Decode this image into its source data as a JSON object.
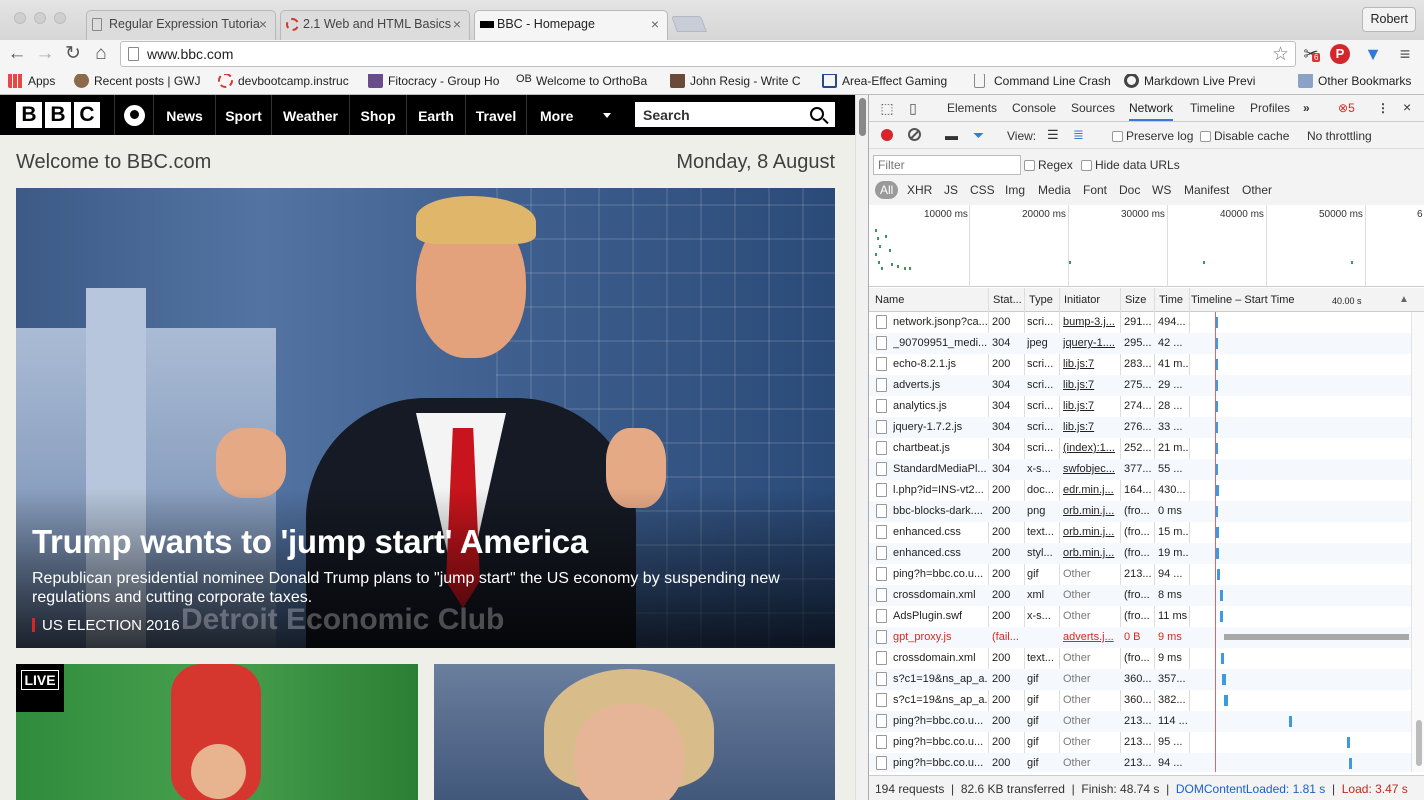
{
  "browser": {
    "tabs": [
      {
        "title": "Regular Expression Tutoria",
        "icon": "doc-icon"
      },
      {
        "title": "2.1 Web and HTML Basics",
        "icon": "ring-icon"
      },
      {
        "title": "BBC - Homepage",
        "icon": "bbc-icon"
      }
    ],
    "user": "Robert",
    "url": "www.bbc.com",
    "extension_badge": "6",
    "bookmarks": [
      "Apps",
      "Recent posts | GWJ",
      "devbootcamp.instruc",
      "Fitocracy - Group Ho",
      "Welcome to OrthoBa",
      "John Resig - Write C",
      "Area-Effect Gaming",
      "Command Line Crash",
      "Markdown Live Previ",
      "Other Bookmarks"
    ]
  },
  "bbc": {
    "logo": [
      "B",
      "B",
      "C"
    ],
    "nav": [
      "News",
      "Sport",
      "Weather",
      "Shop",
      "Earth",
      "Travel",
      "More"
    ],
    "search_placeholder": "Search",
    "welcome": "Welcome to BBC.com",
    "date": "Monday, 8 August",
    "hero": {
      "headline": "Trump wants to 'jump start' America",
      "summary": "Republican presidential nominee Donald Trump plans to \"jump start\" the US economy by suspending new regulations and cutting corporate taxes.",
      "tag": "US ELECTION 2016",
      "backdrop_text": "Detroit Economic Club"
    },
    "live_badge": "LIVE"
  },
  "devtools": {
    "tabs": [
      "Elements",
      "Console",
      "Sources",
      "Network",
      "Timeline",
      "Profiles"
    ],
    "active_tab": "Network",
    "error_count": "5",
    "toolbar": {
      "view_label": "View:",
      "preserve_log": "Preserve log",
      "disable_cache": "Disable cache",
      "throttling": "No throttling"
    },
    "filter_placeholder": "Filter",
    "regex_label": "Regex",
    "hide_data_urls": "Hide data URLs",
    "types": [
      "All",
      "XHR",
      "JS",
      "CSS",
      "Img",
      "Media",
      "Font",
      "Doc",
      "WS",
      "Manifest",
      "Other"
    ],
    "overview_ticks": [
      "10000 ms",
      "20000 ms",
      "30000 ms",
      "40000 ms",
      "50000 ms",
      "6"
    ],
    "columns": {
      "name": "Name",
      "status": "Stat...",
      "type": "Type",
      "initiator": "Initiator",
      "size": "Size",
      "time": "Time",
      "timeline": "Timeline – Start Time",
      "timeline_scale": "40.00 s"
    },
    "rows": [
      {
        "name": "network.jsonp?ca...",
        "status": "200",
        "type": "scri...",
        "initiator": "bump-3.j...",
        "size": "291...",
        "time": "494...",
        "icon": "doc-icon"
      },
      {
        "name": "_90709951_medi...",
        "status": "304",
        "type": "jpeg",
        "initiator": "jquery-1....",
        "size": "295...",
        "time": "42 ...",
        "icon": "image-icon"
      },
      {
        "name": "echo-8.2.1.js",
        "status": "200",
        "type": "scri...",
        "initiator": "lib.js:7",
        "size": "283...",
        "time": "41 m...",
        "icon": "doc-icon"
      },
      {
        "name": "adverts.js",
        "status": "304",
        "type": "scri...",
        "initiator": "lib.js:7",
        "size": "275...",
        "time": "29 ...",
        "icon": "doc-icon"
      },
      {
        "name": "analytics.js",
        "status": "304",
        "type": "scri...",
        "initiator": "lib.js:7",
        "size": "274...",
        "time": "28 ...",
        "icon": "doc-icon"
      },
      {
        "name": "jquery-1.7.2.js",
        "status": "304",
        "type": "scri...",
        "initiator": "lib.js:7",
        "size": "276...",
        "time": "33 ...",
        "icon": "doc-icon"
      },
      {
        "name": "chartbeat.js",
        "status": "304",
        "type": "scri...",
        "initiator": "(index):1...",
        "size": "252...",
        "time": "21 m...",
        "icon": "doc-icon"
      },
      {
        "name": "StandardMediaPl...",
        "status": "304",
        "type": "x-s...",
        "initiator": "swfobjec...",
        "size": "377...",
        "time": "55 ...",
        "icon": "doc-icon"
      },
      {
        "name": "l.php?id=INS-vt2...",
        "status": "200",
        "type": "doc...",
        "initiator": "edr.min.j...",
        "size": "164...",
        "time": "430...",
        "icon": "doc-icon"
      },
      {
        "name": "bbc-blocks-dark....",
        "status": "200",
        "type": "png",
        "initiator": "orb.min.j...",
        "size": "(fro...",
        "time": "0 ms",
        "icon": "image-icon"
      },
      {
        "name": "enhanced.css",
        "status": "200",
        "type": "text...",
        "initiator": "orb.min.j...",
        "size": "(fro...",
        "time": "15 m...",
        "icon": "css-icon"
      },
      {
        "name": "enhanced.css",
        "status": "200",
        "type": "styl...",
        "initiator": "orb.min.j...",
        "size": "(fro...",
        "time": "19 m...",
        "icon": "doc-icon"
      },
      {
        "name": "ping?h=bbc.co.u...",
        "status": "200",
        "type": "gif",
        "initiator": "Other",
        "size": "213...",
        "time": "94 ...",
        "icon": "doc-icon"
      },
      {
        "name": "crossdomain.xml",
        "status": "200",
        "type": "xml",
        "initiator": "Other",
        "size": "(fro...",
        "time": "8 ms",
        "icon": "doc-icon"
      },
      {
        "name": "AdsPlugin.swf",
        "status": "200",
        "type": "x-s...",
        "initiator": "Other",
        "size": "(fro...",
        "time": "11 ms",
        "icon": "doc-icon"
      },
      {
        "name": "gpt_proxy.js",
        "status": "(fail...",
        "type": "",
        "initiator": "adverts.j...",
        "size": "0 B",
        "time": "9 ms",
        "icon": "doc-icon",
        "error": true
      },
      {
        "name": "crossdomain.xml",
        "status": "200",
        "type": "text...",
        "initiator": "Other",
        "size": "(fro...",
        "time": "9 ms",
        "icon": "doc-icon"
      },
      {
        "name": "s?c1=19&ns_ap_a...",
        "status": "200",
        "type": "gif",
        "initiator": "Other",
        "size": "360...",
        "time": "357...",
        "icon": "doc-icon"
      },
      {
        "name": "s?c1=19&ns_ap_a...",
        "status": "200",
        "type": "gif",
        "initiator": "Other",
        "size": "360...",
        "time": "382...",
        "icon": "doc-icon"
      },
      {
        "name": "ping?h=bbc.co.u...",
        "status": "200",
        "type": "gif",
        "initiator": "Other",
        "size": "213...",
        "time": "114 ...",
        "icon": "doc-icon"
      },
      {
        "name": "ping?h=bbc.co.u...",
        "status": "200",
        "type": "gif",
        "initiator": "Other",
        "size": "213...",
        "time": "95 ...",
        "icon": "doc-icon"
      },
      {
        "name": "ping?h=bbc.co.u...",
        "status": "200",
        "type": "gif",
        "initiator": "Other",
        "size": "213...",
        "time": "94 ...",
        "icon": "doc-icon"
      }
    ],
    "summary": {
      "requests": "194 requests",
      "transferred": "82.6 KB transferred",
      "finish": "Finish: 48.74 s",
      "dcl": "DOMContentLoaded: 1.81 s",
      "load": "Load: 3.47 s"
    },
    "colors": {
      "accent": "#3879d9",
      "error": "#d52b1e",
      "record": "#d6262b"
    }
  }
}
